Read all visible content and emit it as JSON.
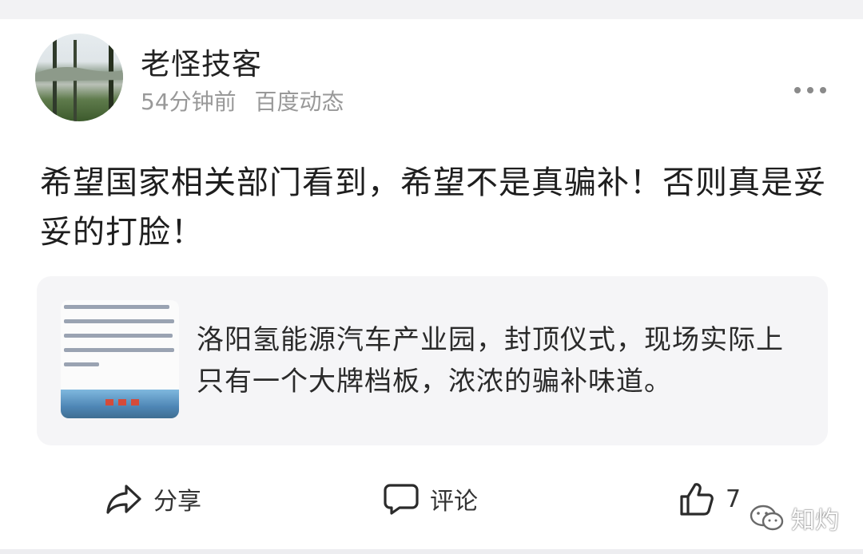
{
  "post": {
    "author": "老怪技客",
    "time": "54分钟前",
    "source": "百度动态",
    "text": "希望国家相关部门看到，希望不是真骗补！否则真是妥妥的打脸！"
  },
  "quoted": {
    "text": "洛阳氢能源汽车产业园，封顶仪式，现场实际上只有一个大牌档板，浓浓的骗补味道。"
  },
  "actions": {
    "share_label": "分享",
    "comment_label": "评论",
    "like_count": "7"
  },
  "watermark": {
    "label": "知灼"
  },
  "icons": {
    "more": "more-dots-icon",
    "share": "share-arrow-icon",
    "comment": "comment-bubble-icon",
    "like": "thumbs-up-icon",
    "wechat": "wechat-icon"
  },
  "colors": {
    "text_primary": "#1e1e1e",
    "text_secondary": "#999999",
    "quote_bg": "#f5f5f7"
  }
}
